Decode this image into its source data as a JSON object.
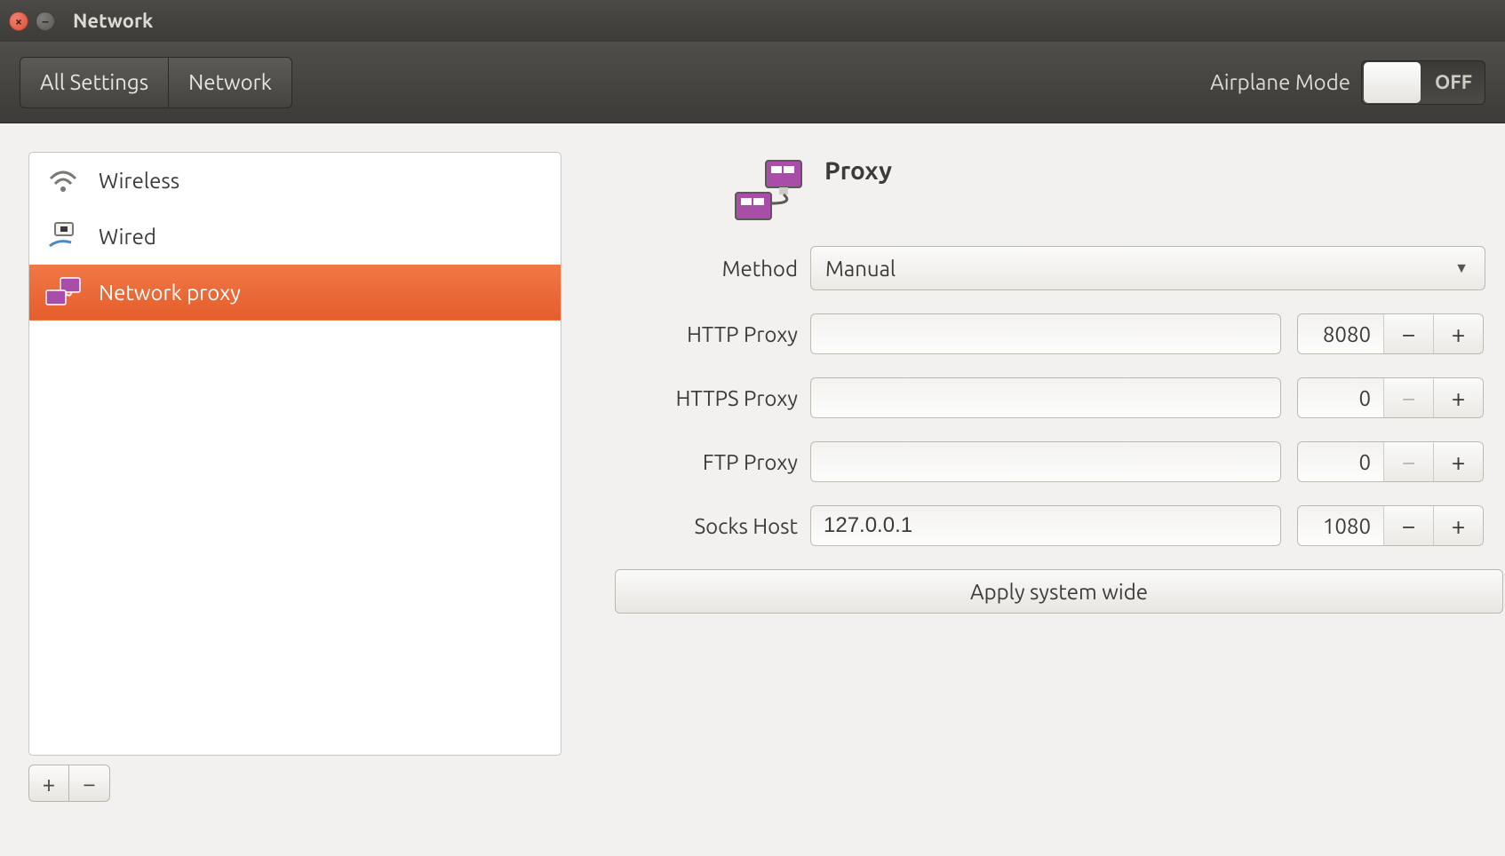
{
  "window": {
    "title": "Network"
  },
  "toolbar": {
    "all_settings": "All Settings",
    "network": "Network",
    "airplane_label": "Airplane Mode",
    "airplane_state": "OFF"
  },
  "sidebar": {
    "items": [
      {
        "label": "Wireless",
        "icon": "wifi-icon",
        "selected": false
      },
      {
        "label": "Wired",
        "icon": "ethernet-icon",
        "selected": false
      },
      {
        "label": "Network proxy",
        "icon": "proxy-icon",
        "selected": true
      }
    ]
  },
  "content": {
    "title": "Proxy",
    "method_label": "Method",
    "method_value": "Manual",
    "rows": [
      {
        "label": "HTTP Proxy",
        "host": "",
        "port": "8080",
        "dec_disabled": false
      },
      {
        "label": "HTTPS Proxy",
        "host": "",
        "port": "0",
        "dec_disabled": true
      },
      {
        "label": "FTP Proxy",
        "host": "",
        "port": "0",
        "dec_disabled": true
      },
      {
        "label": "Socks Host",
        "host": "127.0.0.1",
        "port": "1080",
        "dec_disabled": false
      }
    ],
    "apply_label": "Apply system wide"
  }
}
